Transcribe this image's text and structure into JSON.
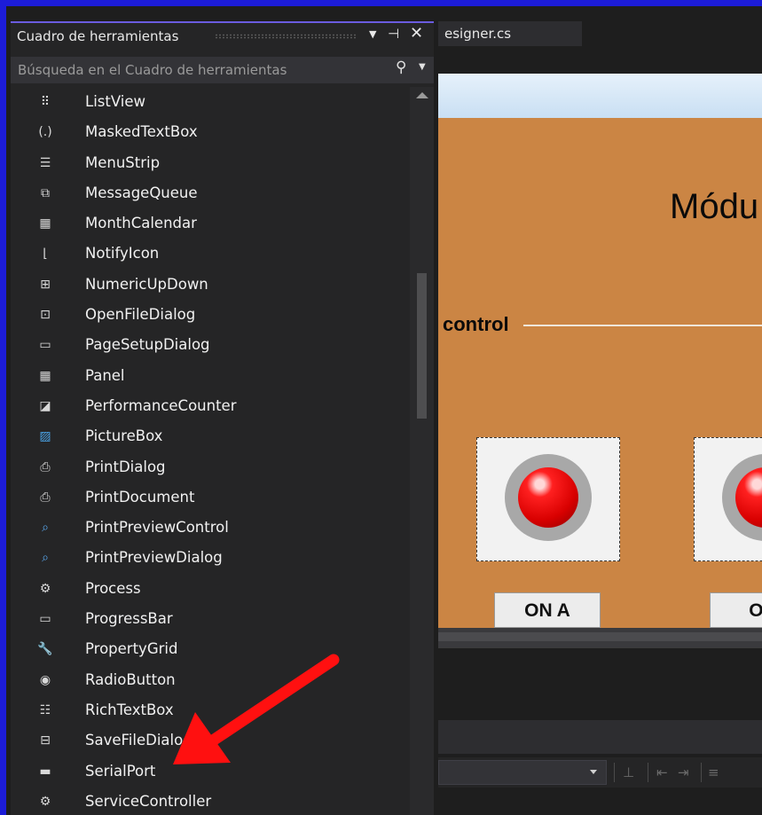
{
  "toolbox": {
    "title": "Cuadro de herramientas",
    "search_placeholder": "Búsqueda en el Cuadro de herramientas",
    "header_icons": [
      "dropdown-icon",
      "pin-icon",
      "close-icon"
    ],
    "items": [
      {
        "label": "ListView",
        "icon": "listview-icon"
      },
      {
        "label": "MaskedTextBox",
        "icon": "maskedtextbox-icon"
      },
      {
        "label": "MenuStrip",
        "icon": "menustrip-icon"
      },
      {
        "label": "MessageQueue",
        "icon": "messagequeue-icon"
      },
      {
        "label": "MonthCalendar",
        "icon": "monthcalendar-icon"
      },
      {
        "label": "NotifyIcon",
        "icon": "notifyicon-icon"
      },
      {
        "label": "NumericUpDown",
        "icon": "numericupdown-icon"
      },
      {
        "label": "OpenFileDialog",
        "icon": "openfiledialog-icon"
      },
      {
        "label": "PageSetupDialog",
        "icon": "pagesetupdialog-icon"
      },
      {
        "label": "Panel",
        "icon": "panel-icon"
      },
      {
        "label": "PerformanceCounter",
        "icon": "performancecounter-icon"
      },
      {
        "label": "PictureBox",
        "icon": "picturebox-icon"
      },
      {
        "label": "PrintDialog",
        "icon": "printdialog-icon"
      },
      {
        "label": "PrintDocument",
        "icon": "printdocument-icon"
      },
      {
        "label": "PrintPreviewControl",
        "icon": "printpreviewcontrol-icon"
      },
      {
        "label": "PrintPreviewDialog",
        "icon": "printpreviewdialog-icon"
      },
      {
        "label": "Process",
        "icon": "process-icon"
      },
      {
        "label": "ProgressBar",
        "icon": "progressbar-icon"
      },
      {
        "label": "PropertyGrid",
        "icon": "propertygrid-icon"
      },
      {
        "label": "RadioButton",
        "icon": "radiobutton-icon"
      },
      {
        "label": "RichTextBox",
        "icon": "richtextbox-icon"
      },
      {
        "label": "SaveFileDialog",
        "icon": "savefiledialog-icon"
      },
      {
        "label": "SerialPort",
        "icon": "serialport-icon"
      },
      {
        "label": "ServiceController",
        "icon": "servicecontroller-icon"
      }
    ]
  },
  "document_tab": {
    "label": "esigner.cs"
  },
  "designer": {
    "heading": "Módu",
    "group_label": "control",
    "buttons": [
      {
        "label": "ON A"
      },
      {
        "label": "ON"
      }
    ]
  },
  "colors": {
    "frame_border": "#1c1cd8",
    "form_background": "#cb8544",
    "led_red": "#ff2020",
    "annotation_arrow": "#ff1010",
    "toolbox_accent": "#6b5ce0"
  }
}
